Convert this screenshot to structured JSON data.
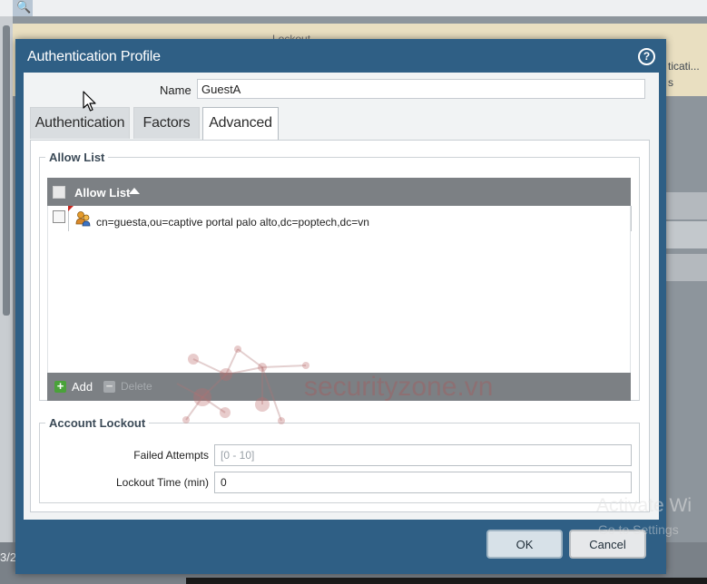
{
  "background": {
    "header_text": "Lockout",
    "right_text_1": "ticati...",
    "right_text_2": "s",
    "bottom_number": "3/2"
  },
  "dialog": {
    "title": "Authentication Profile",
    "help_icon": "?",
    "name_label": "Name",
    "name_value": "GuestA",
    "tabs": [
      {
        "label": "Authentication",
        "active": false
      },
      {
        "label": "Factors",
        "active": false
      },
      {
        "label": "Advanced",
        "active": true
      }
    ],
    "allow_list": {
      "section_title": "Allow List",
      "column_header": "Allow List",
      "sort": "ascending",
      "rows": [
        {
          "icon": "user-group-icon",
          "value": "cn=guesta,ou=captive portal palo alto,dc=poptech,dc=vn"
        }
      ],
      "add_label": "Add",
      "delete_label": "Delete"
    },
    "account_lockout": {
      "section_title": "Account Lockout",
      "failed_attempts_label": "Failed Attempts",
      "failed_attempts_placeholder": "[0 - 10]",
      "lockout_time_label": "Lockout Time (min)",
      "lockout_time_value": "0"
    },
    "buttons": {
      "ok": "OK",
      "cancel": "Cancel"
    }
  },
  "watermarks": {
    "site": "securityzone.vn",
    "activate_line_1": "Activate Wi",
    "activate_line_2": "Go to Settings"
  }
}
